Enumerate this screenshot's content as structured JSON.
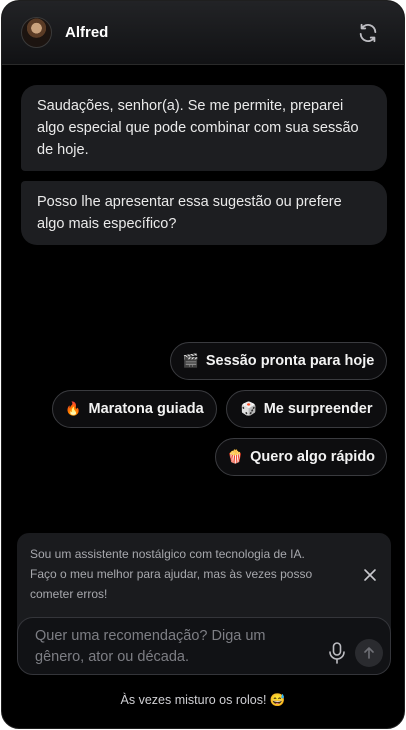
{
  "header": {
    "name": "Alfred",
    "avatar_icon": "butler-avatar-icon",
    "refresh_icon": "refresh-icon"
  },
  "messages": [
    "Saudações, senhor(a). Se me permite, preparei algo especial que pode combinar com sua sessão de hoje.",
    "Posso lhe apresentar essa sugestão ou prefere algo mais específico?"
  ],
  "suggestions": [
    {
      "emoji": "🎬",
      "label": "Sessão pronta para hoje"
    },
    {
      "emoji": "🔥",
      "label": "Maratona guiada"
    },
    {
      "emoji": "🎲",
      "label": "Me surpreender"
    },
    {
      "emoji": "🍿",
      "label": "Quero algo rápido"
    }
  ],
  "disclaimer": {
    "text": "Sou um assistente nostálgico com tecnologia de IA. Faço o meu melhor para ajudar, mas às vezes posso cometer erros!",
    "close_icon": "close-icon"
  },
  "input": {
    "placeholder": "Quer uma recomendação? Diga um gênero, ator ou década.",
    "mic_icon": "microphone-icon",
    "send_icon": "arrow-up-icon"
  },
  "footer": {
    "text": "Às vezes misturo os rolos! 😅"
  },
  "colors": {
    "background": "#000000",
    "bubble": "#1d1e21",
    "chip_border": "#3a3b3f"
  }
}
